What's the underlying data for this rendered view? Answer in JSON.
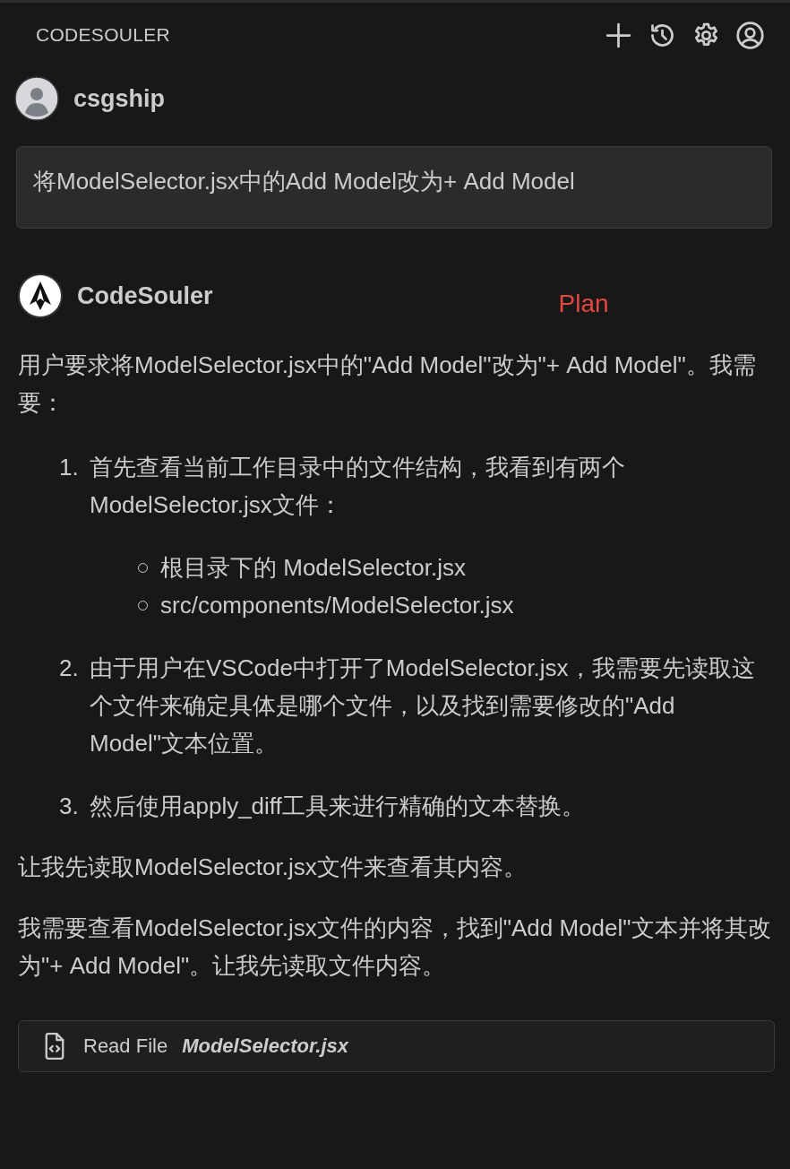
{
  "header": {
    "title": "CODESOULER"
  },
  "user_message": {
    "author": "csgship",
    "text": "将ModelSelector.jsx中的Add Model改为+ Add Model"
  },
  "assistant": {
    "author": "CodeSouler",
    "annotation": "Plan",
    "blocks": [
      {
        "kind": "paragraph",
        "text": "用户要求将ModelSelector.jsx中的\"Add Model\"改为\"+ Add Model\"。我需要："
      },
      {
        "kind": "ordered_list",
        "items": [
          {
            "number": "1.",
            "text": "首先查看当前工作目录中的文件结构，我看到有两个ModelSelector.jsx文件：",
            "children": [
              {
                "text": "根目录下的 ModelSelector.jsx"
              },
              {
                "text": "src/components/ModelSelector.jsx"
              }
            ]
          },
          {
            "number": "2.",
            "text": "由于用户在VSCode中打开了ModelSelector.jsx，我需要先读取这个文件来确定具体是哪个文件，以及找到需要修改的\"Add Model\"文本位置。"
          },
          {
            "number": "3.",
            "text": "然后使用apply_diff工具来进行精确的文本替换。"
          }
        ]
      },
      {
        "kind": "paragraph",
        "text": "让我先读取ModelSelector.jsx文件来查看其内容。"
      },
      {
        "kind": "paragraph",
        "text": "我需要查看ModelSelector.jsx文件的内容，找到\"Add Model\"文本并将其改为\"+ Add Model\"。让我先读取文件内容。"
      }
    ]
  },
  "tool_call": {
    "action": "Read File",
    "target": "ModelSelector.jsx"
  }
}
